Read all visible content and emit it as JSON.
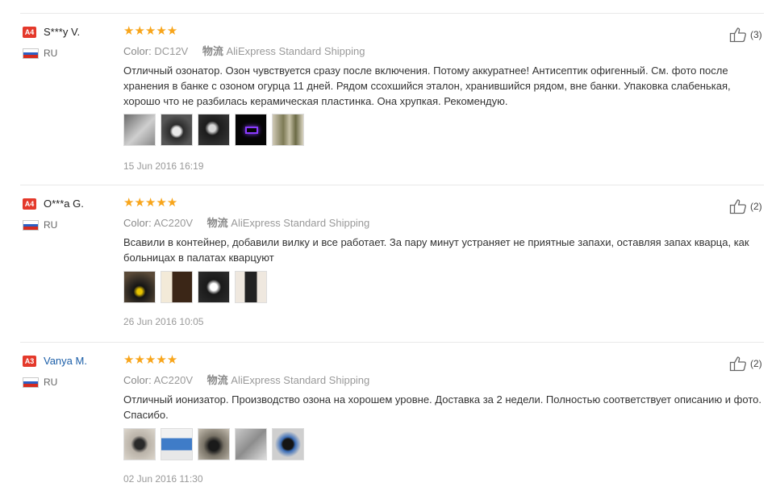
{
  "reviews": [
    {
      "level": "A4",
      "name": "S***y V.",
      "country": "RU",
      "stars": "★★★★★",
      "color_label": "Color:",
      "color_value": "DC12V",
      "logistics_label": "物流",
      "logistics_value": "AliExpress Standard Shipping",
      "text": "Отличный озонатор. Озон чувствуется сразу после включения. Потому аккуратнее! Антисептик офигенный. См. фото после хранения в банке с озоном огурца 11 дней. Рядом ссохшийся эталон, хранившийся рядом, вне банки. Упаковка слабенькая, хорошо что не разбилась керамическая пластинка. Она хрупкая. Рекомендую.",
      "date": "15 Jun 2016 16:19",
      "helpful": "(3)",
      "photos": [
        "photo-1",
        "photo-2",
        "photo-3",
        "photo-4",
        "photo-5"
      ]
    },
    {
      "level": "A4",
      "name": "O***a G.",
      "country": "RU",
      "stars": "★★★★★",
      "color_label": "Color:",
      "color_value": "AC220V",
      "logistics_label": "物流",
      "logistics_value": "AliExpress Standard Shipping",
      "text": "Всавили в контейнер, добавили вилку и все работает. За пару минут устраняет не приятные запахи, оставляя запах кварца, как больницах в палатах кварцуют",
      "date": "26 Jun 2016 10:05",
      "helpful": "(2)",
      "photos": [
        "photo-1",
        "photo-2",
        "photo-3",
        "photo-4"
      ]
    },
    {
      "level": "A3",
      "name": "Vanya M.",
      "country": "RU",
      "stars": "★★★★★",
      "color_label": "Color:",
      "color_value": "AC220V",
      "logistics_label": "物流",
      "logistics_value": "AliExpress Standard Shipping",
      "text": "Отличный ионизатор. Производство озона на хорошем уровне. Доставка за 2 недели. Полностью соответствует описанию и фото. Спасибо.",
      "date": "02 Jun 2016 11:30",
      "helpful": "(2)",
      "photos": [
        "photo-1",
        "photo-2",
        "photo-3",
        "photo-4",
        "photo-5"
      ]
    }
  ],
  "colors": {
    "level_badge": "#e4392b",
    "star": "#f8a51b",
    "link_name": "#1b5ea8"
  }
}
